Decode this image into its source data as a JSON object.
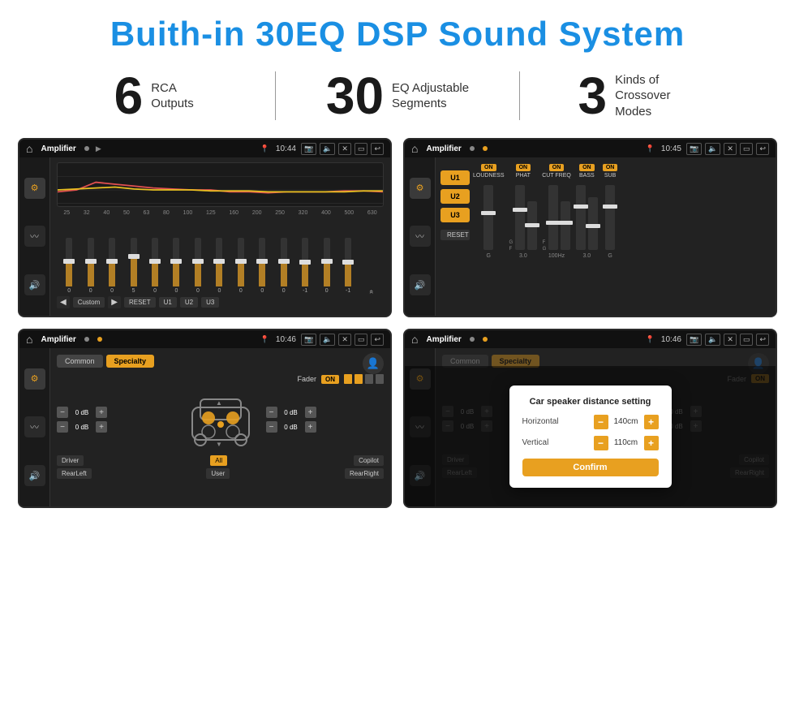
{
  "header": {
    "title": "Buith-in 30EQ DSP Sound System"
  },
  "stats": [
    {
      "number": "6",
      "label": "RCA\nOutputs"
    },
    {
      "number": "30",
      "label": "EQ Adjustable\nSegments"
    },
    {
      "number": "3",
      "label": "Kinds of\nCrossover Modes"
    }
  ],
  "screens": [
    {
      "id": "screen1",
      "statusBar": {
        "appName": "Amplifier",
        "time": "10:44",
        "dots": [
          "gray",
          "gray"
        ]
      }
    },
    {
      "id": "screen2",
      "statusBar": {
        "appName": "Amplifier",
        "time": "10:45",
        "dots": [
          "gray",
          "orange"
        ]
      }
    },
    {
      "id": "screen3",
      "statusBar": {
        "appName": "Amplifier",
        "time": "10:46",
        "dots": [
          "gray",
          "orange"
        ]
      }
    },
    {
      "id": "screen4",
      "statusBar": {
        "appName": "Amplifier",
        "time": "10:46",
        "dots": [
          "gray",
          "orange"
        ]
      }
    }
  ],
  "eq": {
    "freqLabels": [
      "25",
      "32",
      "40",
      "50",
      "63",
      "80",
      "100",
      "125",
      "160",
      "200",
      "250",
      "320",
      "400",
      "500",
      "630"
    ],
    "values": [
      "0",
      "0",
      "0",
      "5",
      "0",
      "0",
      "0",
      "0",
      "0",
      "0",
      "0",
      "-1",
      "0",
      "-1"
    ],
    "presets": [
      "Custom"
    ],
    "buttons": [
      "RESET",
      "U1",
      "U2",
      "U3"
    ]
  },
  "crossover": {
    "presets": [
      "U1",
      "U2",
      "U3"
    ],
    "channels": [
      {
        "on": true,
        "name": "LOUDNESS"
      },
      {
        "on": true,
        "name": "PHAT"
      },
      {
        "on": true,
        "name": "CUT FREQ"
      },
      {
        "on": true,
        "name": "BASS"
      },
      {
        "on": true,
        "name": "SUB"
      }
    ],
    "resetLabel": "RESET"
  },
  "fader": {
    "tabs": [
      "Common",
      "Specialty"
    ],
    "activeTab": 1,
    "faderLabel": "Fader",
    "onLabel": "ON",
    "positions": {
      "driver": "Driver",
      "copilot": "Copilot",
      "rearLeft": "RearLeft",
      "all": "All",
      "user": "User",
      "rearRight": "RearRight"
    },
    "leftValues": [
      "0 dB",
      "0 dB"
    ],
    "rightValues": [
      "0 dB",
      "0 dB"
    ]
  },
  "dialog": {
    "title": "Car speaker distance setting",
    "fields": [
      {
        "label": "Horizontal",
        "value": "140cm"
      },
      {
        "label": "Vertical",
        "value": "110cm"
      }
    ],
    "confirmLabel": "Confirm"
  }
}
